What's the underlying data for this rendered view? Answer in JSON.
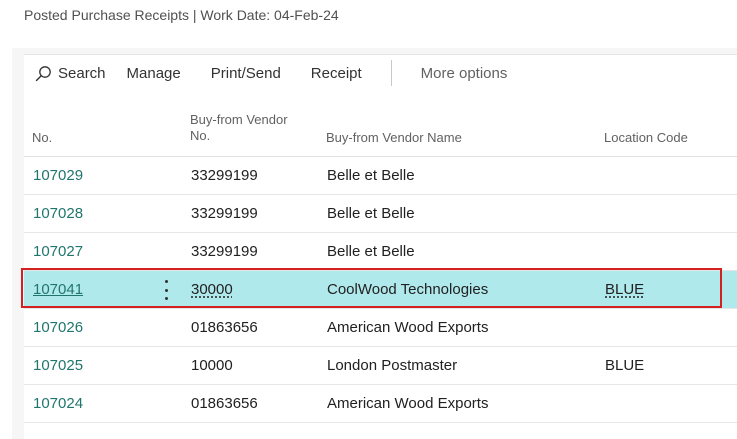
{
  "page": {
    "title": "Posted Purchase Receipts | Work Date: 04-Feb-24"
  },
  "toolbar": {
    "search_label": "Search",
    "manage_label": "Manage",
    "print_send_label": "Print/Send",
    "receipt_label": "Receipt",
    "more_options_label": "More options"
  },
  "table": {
    "headers": {
      "no": "No.",
      "vendor_no": "Buy-from Vendor No.",
      "vendor_name": "Buy-from Vendor Name",
      "location_code": "Location Code"
    },
    "rows": [
      {
        "no": "107029",
        "vendor_no": "33299199",
        "vendor_name": "Belle et Belle",
        "location_code": ""
      },
      {
        "no": "107028",
        "vendor_no": "33299199",
        "vendor_name": "Belle et Belle",
        "location_code": ""
      },
      {
        "no": "107027",
        "vendor_no": "33299199",
        "vendor_name": "Belle et Belle",
        "location_code": ""
      },
      {
        "no": "107041",
        "vendor_no": "30000",
        "vendor_name": "CoolWood Technologies",
        "location_code": "BLUE"
      },
      {
        "no": "107026",
        "vendor_no": "01863656",
        "vendor_name": "American Wood Exports",
        "location_code": ""
      },
      {
        "no": "107025",
        "vendor_no": "10000",
        "vendor_name": "London Postmaster",
        "location_code": "BLUE"
      },
      {
        "no": "107024",
        "vendor_no": "01863656",
        "vendor_name": "American Wood Exports",
        "location_code": ""
      }
    ]
  },
  "colors": {
    "link": "#20766e",
    "selected_row": "#b0e9ec",
    "highlight_outline": "#d42020"
  },
  "icons": {
    "search": "search-icon",
    "row_actions": "more-vertical-icon"
  }
}
